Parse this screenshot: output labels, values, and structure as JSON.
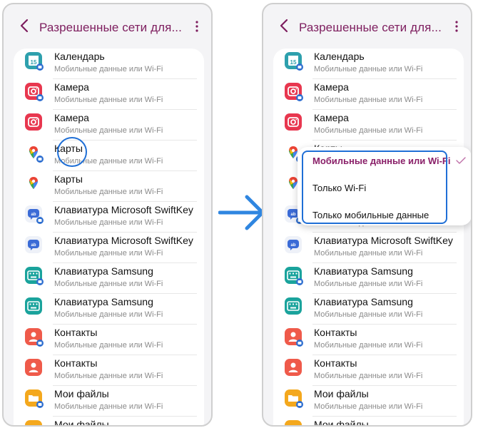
{
  "header": {
    "title": "Разрешенные сети для..."
  },
  "apps": [
    {
      "name": "Календарь",
      "sub": "Мобильные данные или Wi-Fi",
      "icon": "calendar-icon",
      "icon_color": "#2ea0ad",
      "badge_text": "15"
    },
    {
      "name": "Камера",
      "sub": "Мобильные данные или Wi-Fi",
      "icon": "camera-icon",
      "icon_color": "#e8374f"
    },
    {
      "name": "Камера",
      "sub": "Мобильные данные или Wi-Fi",
      "icon": "camera-icon",
      "icon_color": "#e8374f"
    },
    {
      "name": "Карты",
      "sub": "Мобильные данные или Wi-Fi",
      "icon": "google-maps-icon",
      "icon_color": "#34a853"
    },
    {
      "name": "Карты",
      "sub": "Мобильные данные или Wi-Fi",
      "icon": "google-maps-icon",
      "icon_color": "#34a853"
    },
    {
      "name": "Клавиатура Microsoft SwiftKey",
      "sub": "Мобильные данные или Wi-Fi",
      "icon": "swiftkey-icon",
      "icon_color": "#3b6bd6"
    },
    {
      "name": "Клавиатура Microsoft SwiftKey",
      "sub": "Мобильные данные или Wi-Fi",
      "icon": "swiftkey-icon",
      "icon_color": "#3b6bd6"
    },
    {
      "name": "Клавиатура Samsung",
      "sub": "Мобильные данные или Wi-Fi",
      "icon": "samsung-keyboard-icon",
      "icon_color": "#1aa39c"
    },
    {
      "name": "Клавиатура Samsung",
      "sub": "Мобильные данные или Wi-Fi",
      "icon": "samsung-keyboard-icon",
      "icon_color": "#1aa39c"
    },
    {
      "name": "Контакты",
      "sub": "Мобильные данные или Wi-Fi",
      "icon": "contacts-icon",
      "icon_color": "#ef5a4a"
    },
    {
      "name": "Контакты",
      "sub": "Мобильные данные или Wi-Fi",
      "icon": "contacts-icon",
      "icon_color": "#ef5a4a"
    },
    {
      "name": "Мои файлы",
      "sub": "Мобильные данные или Wi-Fi",
      "icon": "my-files-icon",
      "icon_color": "#f4a81d"
    },
    {
      "name": "Мои файлы",
      "sub": "Мобильные данные или Wi-Fi",
      "icon": "my-files-icon",
      "icon_color": "#f4a81d"
    }
  ],
  "dropdown": {
    "options": [
      "Мобильные данные или Wi-Fi",
      "Только Wi-Fi",
      "Только мобильные данные"
    ],
    "selected": "Мобильные данные или Wi-Fi",
    "accent_color": "#8a2069"
  },
  "annotation_color": "#1f6fd6"
}
